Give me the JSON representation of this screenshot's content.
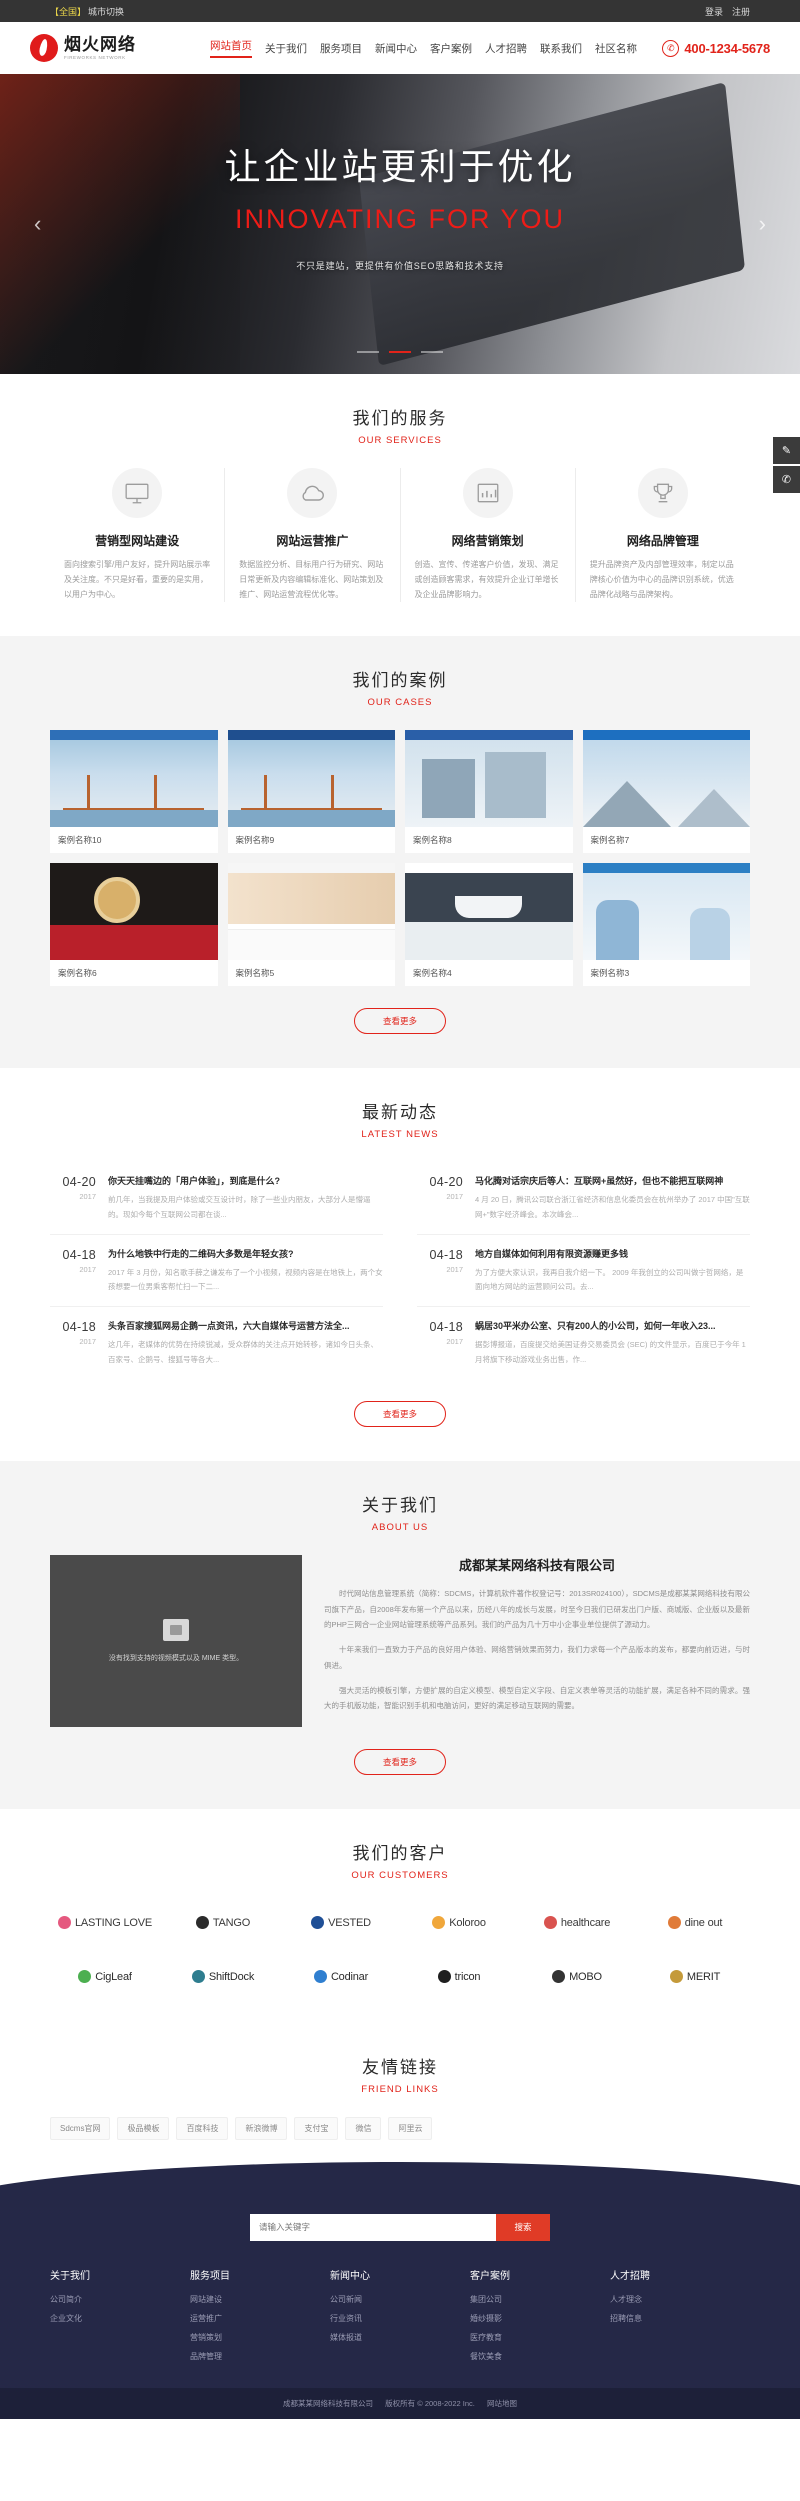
{
  "topbar": {
    "city_tag": "【全国】",
    "city_label": "城市切换",
    "login": "登录",
    "register": "注册"
  },
  "header": {
    "logo_cn": "烟火网络",
    "logo_en": "FIREWORKS NETWORK",
    "nav": [
      {
        "label": "网站首页",
        "active": true
      },
      {
        "label": "关于我们",
        "active": false
      },
      {
        "label": "服务项目",
        "active": false
      },
      {
        "label": "新闻中心",
        "active": false
      },
      {
        "label": "客户案例",
        "active": false
      },
      {
        "label": "人才招聘",
        "active": false
      },
      {
        "label": "联系我们",
        "active": false
      },
      {
        "label": "社区名称",
        "active": false
      }
    ],
    "phone": "400-1234-5678"
  },
  "banner": {
    "title": "让企业站更利于优化",
    "subtitle_en": "INNOVATING FOR YOU",
    "tagline": "不只是建站，更提供有价值SEO思路和技术支持",
    "prev": "‹",
    "next": "›"
  },
  "services": {
    "heading_cn": "我们的服务",
    "heading_en": "OUR SERVICES",
    "items": [
      {
        "icon": "monitor-icon",
        "title": "营销型网站建设",
        "desc": "面向搜索引擎/用户友好，提升网站展示率及关注度。不只是好看，重要的是实用，以用户为中心。"
      },
      {
        "icon": "cloud-icon",
        "title": "网站运营推广",
        "desc": "数据监控分析、目标用户行为研究、网站日常更新及内容编辑标准化、网站策划及推广、网站运营流程优化等。"
      },
      {
        "icon": "chart-icon",
        "title": "网络营销策划",
        "desc": "创造、宣传、传递客户价值，发现、满足或创造顾客需求，有效提升企业订单增长及企业品牌影响力。"
      },
      {
        "icon": "trophy-icon",
        "title": "网络品牌管理",
        "desc": "提升品牌资产及内部管理效率，制定以品牌核心价值为中心的品牌识别系统，优选品牌化战略与品牌架构。"
      }
    ]
  },
  "cases": {
    "heading_cn": "我们的案例",
    "heading_en": "OUR CASES",
    "more_label": "查看更多",
    "items": [
      {
        "caption": "案例名称10",
        "accent": "#2e6fb7",
        "style": "bridge"
      },
      {
        "caption": "案例名称9",
        "accent": "#1f4f8f",
        "style": "bridge"
      },
      {
        "caption": "案例名称8",
        "accent": "#2a5fa8",
        "style": "building"
      },
      {
        "caption": "案例名称7",
        "accent": "#1d6fc0",
        "style": "mountain"
      },
      {
        "caption": "案例名称6",
        "accent": "#b9202a",
        "style": "food"
      },
      {
        "caption": "案例名称5",
        "accent": "#e0872c",
        "style": "shop"
      },
      {
        "caption": "案例名称4",
        "accent": "#2f3b48",
        "style": "bath"
      },
      {
        "caption": "案例名称3",
        "accent": "#2c7fc4",
        "style": "people"
      }
    ]
  },
  "news": {
    "heading_cn": "最新动态",
    "heading_en": "LATEST NEWS",
    "more_label": "查看更多",
    "left": [
      {
        "date": "04-20",
        "year": "2017",
        "title": "你天天挂嘴边的「用户体验」，到底是什么?",
        "summary": "前几年，当我提及用户体验或交互设计时，除了一些业内朋友，大部分人是懵逼的。现如今每个互联网公司都在谈..."
      },
      {
        "date": "04-18",
        "year": "2017",
        "title": "为什么地铁中行走的二维码大多数是年轻女孩?",
        "summary": "2017 年 3 月份，知名歌手薛之谦发布了一个小视频，视频内容是在地铁上，两个女孩想要一位男乘客帮忙扫一下二..."
      },
      {
        "date": "04-18",
        "year": "2017",
        "title": "头条百家搜狐网易企鹅一点资讯，六大自媒体号运营方法全...",
        "summary": "这几年，老媒体的优势在持续锐减，受众群体的关注点开始转移，诸如今日头条、百家号、企鹅号、搜狐号等各大..."
      }
    ],
    "right": [
      {
        "date": "04-20",
        "year": "2017",
        "title": "马化腾对话宗庆后等人：互联网+虽然好，但也不能把互联网神",
        "summary": "4 月 20 日，腾讯公司联合浙江省经济和信息化委员会在杭州举办了 2017 中国\"互联网+\"数字经济峰会。本次峰会..."
      },
      {
        "date": "04-18",
        "year": "2017",
        "title": "地方自媒体如何利用有限资源赚更多钱",
        "summary": "为了方便大家认识，我再自我介绍一下。 2009 年我创立的公司叫做宁哲网络，是面向地方网站的运营顾问公司。去..."
      },
      {
        "date": "04-18",
        "year": "2017",
        "title": "蜗居30平米办公室、只有200人的小公司，如何一年收入23...",
        "summary": "据彭博报道，百度提交给美国证券交易委员会 (SEC) 的文件显示，百度已于今年 1 月将旗下移动游戏业务出售，作..."
      }
    ]
  },
  "about": {
    "heading_cn": "关于我们",
    "heading_en": "ABOUT US",
    "image_alt": "没有找到支持的视频模式以及 MIME 类型。",
    "company": "成都某某网络科技有限公司",
    "paragraphs": [
      "时代网站信息管理系统（简称：SDCMS，计算机软件著作权登记号：2013SR024100），SDCMS是成都某某网络科技有限公司旗下产品，自2008年发布第一个产品以来，历经八年的成长与发展，时至今日我们已研发出门户版、商城版、企业版以及最新的PHP三网合一企业网站管理系统等产品系列。我们的产品为几十万中小企事业单位提供了源动力。",
      "十年来我们一直致力于产品的良好用户体验、网络营销效果而努力，我们力求每一个产品版本的发布，都要向前迈进，与时俱进。",
      "强大灵活的模板引擎，方便扩展的自定义模型、模型自定义字段、自定义表单等灵活的功能扩展，满足各种不同的需求。强大的手机版功能，智能识别手机和电脑访问，更好的满足移动互联网的需要。"
    ],
    "more_label": "查看更多"
  },
  "customers": {
    "heading_cn": "我们的客户",
    "heading_en": "OUR CUSTOMERS",
    "items": [
      {
        "name": "LASTING LOVE",
        "color": "#e5597f",
        "icon": "lotus-icon"
      },
      {
        "name": "TANGO",
        "color": "#2b2b2b",
        "icon": "hat-icon"
      },
      {
        "name": "VESTED",
        "color": "#1f4f96",
        "icon": "shield-icon"
      },
      {
        "name": "Koloroo",
        "color": "#f0a73b",
        "icon": "swoosh-icon"
      },
      {
        "name": "healthcare",
        "color": "#d9534f",
        "icon": "heart-icon"
      },
      {
        "name": "dine out",
        "color": "#e07b39",
        "icon": "fork-icon"
      },
      {
        "name": "CigLeaf",
        "color": "#4caf50",
        "icon": "leaf-icon"
      },
      {
        "name": "ShiftDock",
        "color": "#2e7d8f",
        "icon": "dock-icon"
      },
      {
        "name": "Codinar",
        "color": "#2f7fd0",
        "icon": "code-icon"
      },
      {
        "name": "tricon",
        "color": "#1f1f1f",
        "icon": "consulting-icon"
      },
      {
        "name": "MOBO",
        "color": "#333333",
        "icon": "mobo-icon"
      },
      {
        "name": "MERIT",
        "color": "#c49a3a",
        "icon": "quill-icon"
      }
    ]
  },
  "friend_links": {
    "heading_cn": "友情链接",
    "heading_en": "FRIEND LINKS",
    "items": [
      "Sdcms官网",
      "极品模板",
      "百度科技",
      "新浪微博",
      "支付宝",
      "微信",
      "阿里云"
    ]
  },
  "footer": {
    "search_placeholder": "请输入关键字",
    "search_value": "",
    "search_button": "搜索",
    "columns": [
      {
        "title": "关于我们",
        "links": [
          "公司简介",
          "企业文化"
        ]
      },
      {
        "title": "服务项目",
        "links": [
          "网站建设",
          "运营推广",
          "营销策划",
          "品牌管理"
        ]
      },
      {
        "title": "新闻中心",
        "links": [
          "公司新闻",
          "行业资讯",
          "媒体报道"
        ]
      },
      {
        "title": "客户案例",
        "links": [
          "集团公司",
          "婚纱摄影",
          "医疗教育",
          "餐饮美食"
        ]
      },
      {
        "title": "人才招聘",
        "links": [
          "人才理念",
          "招聘信息"
        ]
      }
    ],
    "copyright_company": "成都某某网络科技有限公司",
    "copyright_text": "版权所有 © 2008-2022 Inc.",
    "sitemap": "网站地图"
  },
  "side_tools": [
    {
      "icon": "message-icon",
      "glyph": "✎"
    },
    {
      "icon": "phone-icon",
      "glyph": "✆"
    }
  ],
  "colors": {
    "accent_red": "#e1231a",
    "footer_navy": "#252847",
    "dark_bar": "#343434"
  }
}
